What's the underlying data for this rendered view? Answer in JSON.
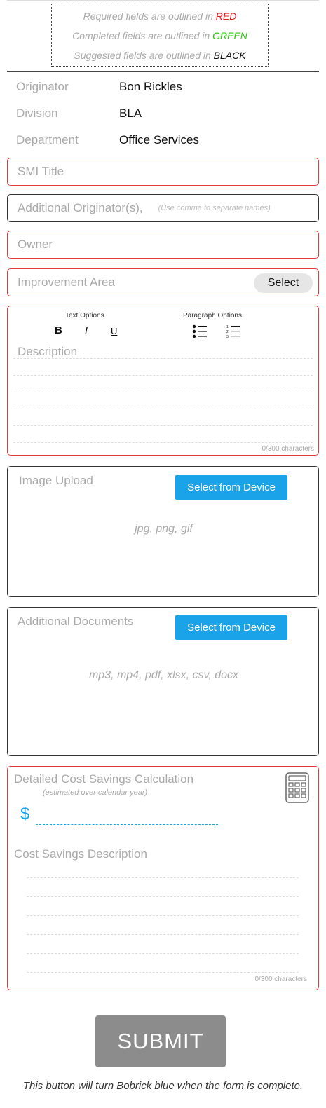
{
  "legend": {
    "required_prefix": "Required fields are outlined in ",
    "required_color_word": "RED",
    "completed_prefix": "Completed fields are outlined in ",
    "completed_color_word": "GREEN",
    "suggested_prefix": "Suggested fields are outlined in ",
    "suggested_color_word": "BLACK"
  },
  "info": {
    "originator_label": "Originator",
    "originator_value": "Bon Rickles",
    "division_label": "Division",
    "division_value": "BLA",
    "department_label": "Department",
    "department_value": "Office Services"
  },
  "fields": {
    "smi_title": "SMI Title",
    "additional_originators": "Additional Originator(s),",
    "additional_originators_hint": "(Use comma to separate names)",
    "owner": "Owner",
    "improvement_area": "Improvement Area",
    "improvement_select": "Select"
  },
  "description": {
    "text_options": "Text Options",
    "paragraph_options": "Paragraph Options",
    "bold": "B",
    "italic": "I",
    "underline": "U",
    "label": "Description",
    "count": "0/300 characters"
  },
  "image_upload": {
    "label": "Image Upload",
    "button": "Select from Device",
    "formats": "jpg, png, gif"
  },
  "documents": {
    "label": "Additional Documents",
    "button": "Select from Device",
    "formats": "mp3, mp4, pdf, xlsx, csv, docx"
  },
  "cost": {
    "title": "Detailed Cost Savings Calculation",
    "subtitle": "(estimated over calendar year)",
    "currency": "$",
    "description_label": "Cost Savings Description",
    "count": "0/300 characters",
    "icon": "calculator-icon"
  },
  "submit": {
    "label": "SUBMIT",
    "note": "This button will turn Bobrick blue when the form is complete."
  },
  "colors": {
    "required": "#e41b17",
    "completed": "#27c80a",
    "accent_blue": "#1aa3e8",
    "submit_gray": "#8c8c8c"
  }
}
